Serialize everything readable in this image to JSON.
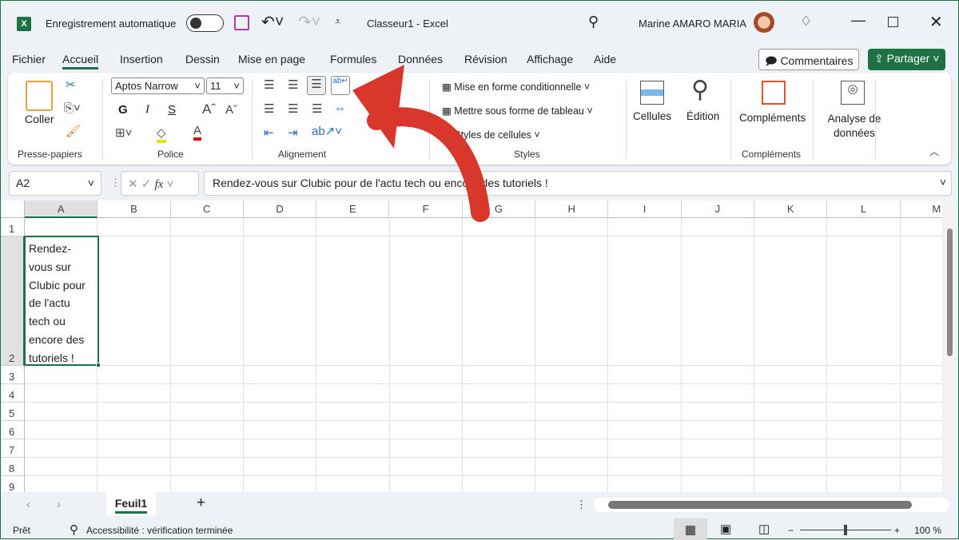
{
  "titlebar": {
    "autosave_label": "Enregistrement automatique",
    "autosave_on": false,
    "title": "Classeur1  -  Excel",
    "user": "Marine AMARO MARIA"
  },
  "tabs": [
    "Fichier",
    "Accueil",
    "Insertion",
    "Dessin",
    "Mise en page",
    "Formules",
    "Données",
    "Révision",
    "Affichage",
    "Aide"
  ],
  "active_tab": "Accueil",
  "buttons": {
    "comments": "Commentaires",
    "share": "Partager"
  },
  "ribbon": {
    "clipboard": {
      "paste": "Coller",
      "group": "Presse-papiers"
    },
    "font": {
      "name": "Aptos Narrow",
      "size": "11",
      "bold": "G",
      "italic": "I",
      "underline": "S",
      "group": "Police"
    },
    "alignment": {
      "group": "Alignement"
    },
    "styles": {
      "conditional": "Mise en forme conditionnelle",
      "table": "Mettre sous forme de tableau",
      "cell_styles": "Styles de cellules",
      "group": "Styles"
    },
    "cells": "Cellules",
    "editing": "Édition",
    "addins": "Compléments",
    "addins_group": "Compléments",
    "analyze": "Analyse de données"
  },
  "formula_bar": {
    "name_box": "A2",
    "fx": "fx",
    "content": "Rendez-vous sur Clubic pour de l'actu tech ou encore des tutoriels !"
  },
  "columns": [
    "A",
    "B",
    "C",
    "D",
    "E",
    "F",
    "G",
    "H",
    "I",
    "J",
    "K",
    "L",
    "M"
  ],
  "rows": [
    "1",
    "2",
    "3",
    "4",
    "5",
    "6",
    "7",
    "8",
    "9"
  ],
  "cell_a2": "Rendez-vous sur Clubic pour de l'actu tech ou encore des tutoriels !",
  "sheets": [
    "Feuil1"
  ],
  "status": {
    "ready": "Prêt",
    "accessibility": "Accessibilité : vérification terminée",
    "zoom": "100 %"
  },
  "colors": {
    "accent": "#1e7145",
    "arrow": "#d9372b"
  }
}
